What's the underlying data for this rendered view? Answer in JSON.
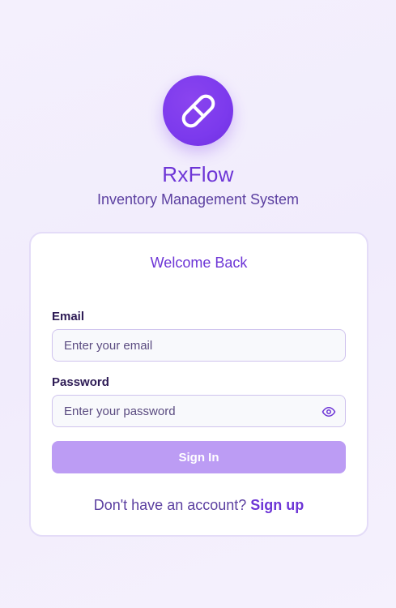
{
  "brand": {
    "logo_icon": "pill-icon",
    "title": "RxFlow",
    "subtitle": "Inventory Management System"
  },
  "login_card": {
    "heading": "Welcome Back",
    "email": {
      "label": "Email",
      "placeholder": "Enter your email",
      "value": ""
    },
    "password": {
      "label": "Password",
      "placeholder": "Enter your password",
      "value": "",
      "toggle_icon": "eye-icon"
    },
    "submit_label": "Sign In",
    "signup_prompt": "Don't have an account?",
    "signup_link": "Sign up"
  },
  "colors": {
    "accent": "#7c3aed",
    "button_disabled": "#bc9cf4",
    "background": "#f3effc"
  }
}
